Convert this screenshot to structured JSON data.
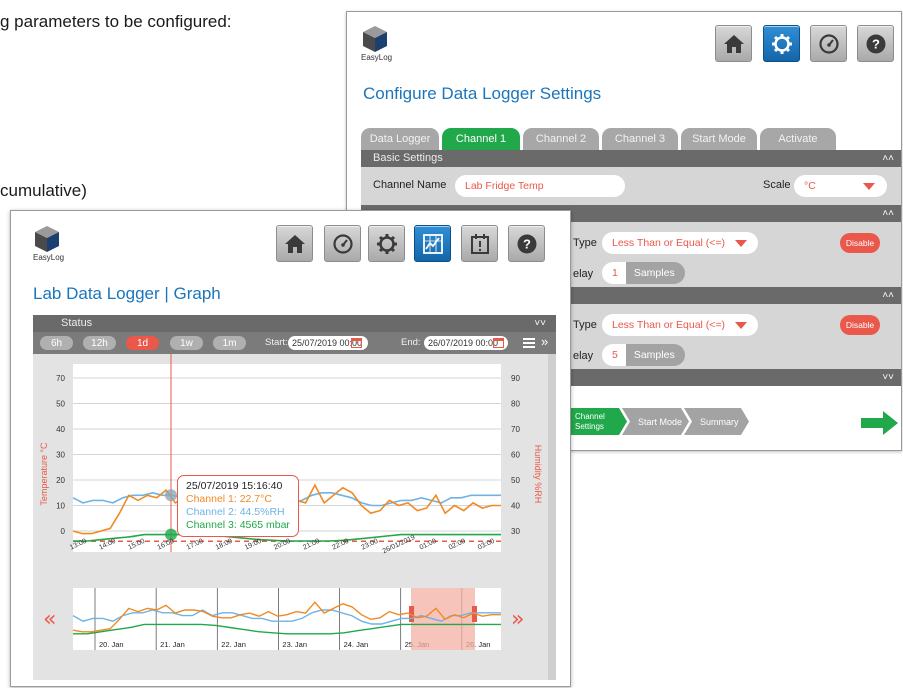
{
  "background": {
    "line1": "g parameters to be configured:",
    "line2": "cumulative)"
  },
  "settings_window": {
    "logo_text": "EasyLog",
    "title": "Configure Data Logger Settings",
    "header_buttons": [
      {
        "icon": "home-icon"
      },
      {
        "icon": "gear-icon",
        "active": true
      },
      {
        "icon": "gauge-icon"
      },
      {
        "icon": "help-icon"
      }
    ],
    "tabs": [
      "Data Logger",
      "Channel 1",
      "Channel 2",
      "Channel 3",
      "Start Mode",
      "Activate"
    ],
    "active_tab": "Channel 1",
    "basic_settings_label": "Basic Settings",
    "channel_name_label": "Channel Name",
    "channel_name_value": "Lab Fridge Temp",
    "scale_label": "Scale",
    "scale_value": "°C",
    "alarm1": {
      "type_label": "Type",
      "type_value": "Less Than or Equal (<=)",
      "delay_label": "elay",
      "delay_value": "1",
      "delay_unit": "Samples",
      "disable_label": "Disable"
    },
    "alarm2": {
      "type_label": "Type",
      "type_value": "Less Than or Equal (<=)",
      "delay_label": "elay",
      "delay_value": "5",
      "delay_unit": "Samples",
      "disable_label": "Disable"
    },
    "wizard": [
      "Channel Settings",
      "Start Mode",
      "Summary"
    ],
    "colors": {
      "accent_blue": "#1b75bb",
      "accent_green": "#21a84a",
      "accent_red": "#e9584a"
    }
  },
  "graph_window": {
    "logo_text": "EasyLog",
    "title": "Lab Data Logger | Graph",
    "header_buttons": [
      {
        "icon": "home-icon"
      },
      {
        "icon": "gauge-icon"
      },
      {
        "icon": "gear-icon"
      },
      {
        "icon": "graph-icon",
        "active": true
      },
      {
        "icon": "alarm-icon"
      },
      {
        "icon": "help-icon"
      }
    ],
    "status_label": "Status",
    "ranges": [
      "6h",
      "12h",
      "1d",
      "1w",
      "1m"
    ],
    "active_range": "1d",
    "start_label": "Start:",
    "start_value": "25/07/2019 00:00",
    "end_label": "End:",
    "end_value": "26/07/2019 00:00",
    "tooltip": {
      "time": "25/07/2019  15:16:40",
      "ch1": "Channel 1: 22.7°C",
      "ch2": "Channel 2: 44.5%RH",
      "ch3": "Channel 3: 4565 mbar"
    }
  },
  "chart_data": {
    "type": "line",
    "y_left_label": "Temperature °C",
    "y_right_label": "Humidity %RH",
    "y_left_ticks": [
      "70",
      "50",
      "40",
      "30",
      "20",
      "10",
      "0"
    ],
    "y_right_ticks": [
      "90",
      "80",
      "70",
      "60",
      "50",
      "40",
      "30"
    ],
    "x_ticks": [
      "13:00",
      "14:00",
      "15:00",
      "16:00",
      "17:00",
      "18:00",
      "19:00",
      "20:00",
      "21:00",
      "22:00",
      "23:00",
      "26/01/2019",
      "01:00",
      "02:00",
      "03:00"
    ],
    "overview_ticks": [
      "20. Jan",
      "21. Jan",
      "22. Jan",
      "23. Jan",
      "24. Jan",
      "25. Jan",
      "26. Jan"
    ],
    "series": [
      {
        "color": "#f08a24",
        "values": [
          0,
          -1,
          -1,
          0,
          1,
          7,
          14,
          12,
          14,
          13,
          16,
          11,
          13,
          13,
          12,
          9,
          8,
          8,
          10,
          11,
          9,
          12,
          9,
          10,
          12,
          11,
          18,
          11,
          14,
          17,
          15,
          10,
          7,
          8,
          12,
          10,
          11,
          8,
          9,
          14,
          7,
          10,
          8,
          11,
          9,
          10,
          10
        ]
      },
      {
        "color": "#6fb3e6",
        "values": [
          43,
          41,
          42,
          42,
          41,
          43,
          44,
          44,
          45,
          44,
          44,
          43,
          43,
          45,
          43,
          44,
          44,
          43,
          42,
          42,
          41,
          41,
          41,
          42,
          44,
          45,
          45,
          44,
          43,
          41,
          40,
          40,
          41,
          42,
          42,
          43,
          42,
          41,
          43,
          43,
          44,
          44,
          44,
          44
        ]
      },
      {
        "color": "#21a84a",
        "values": [
          4520,
          4520,
          4530,
          4540,
          4550,
          4565,
          4565,
          4565,
          4565,
          4565,
          4560,
          4550,
          4540,
          4530,
          4525,
          4520,
          4520,
          4520,
          4520,
          4525,
          4535,
          4545,
          4555,
          4565,
          4565,
          4565,
          4565,
          4565,
          4565,
          4565,
          4565
        ]
      }
    ],
    "threshold_color": "#e9584a"
  }
}
